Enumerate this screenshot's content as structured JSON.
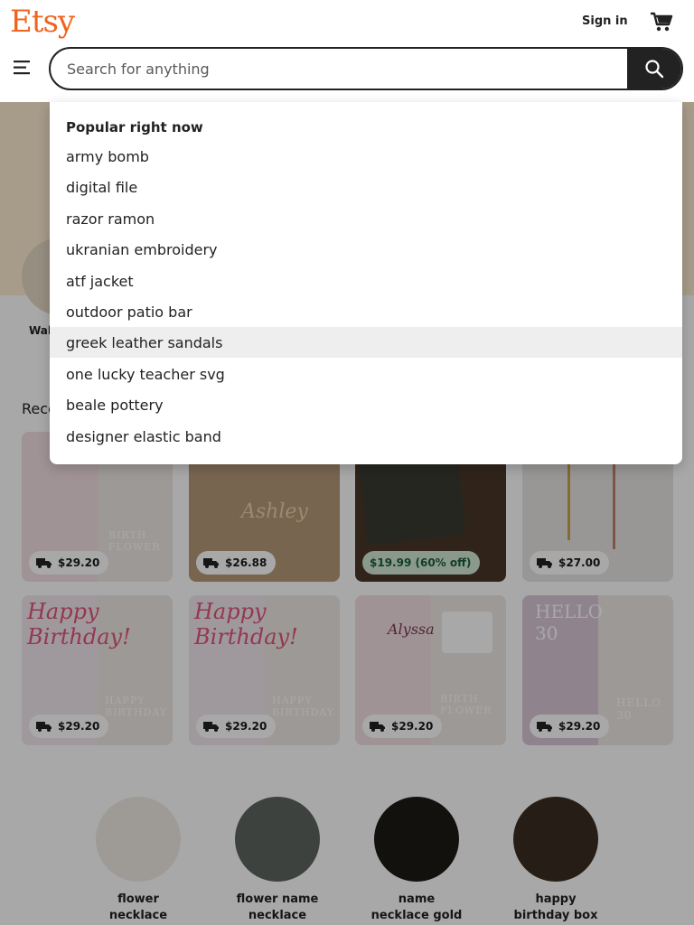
{
  "header": {
    "logo": "Etsy",
    "sign_in": "Sign in",
    "search_placeholder": "Search for anything"
  },
  "colors": {
    "brand": "#F1641E",
    "sale_bg": "#D4E9D7",
    "highlight": "#EEEEEE"
  },
  "dropdown": {
    "title": "Popular right now",
    "items": [
      "army bomb",
      "digital file",
      "razor ramon",
      "ukranian embroidery",
      "atf jacket",
      "outdoor patio bar",
      "greek leather sandals",
      "one lucky teacher svg",
      "beale pottery",
      "designer elastic band"
    ],
    "highlighted_index": 6
  },
  "page": {
    "partial_category_label": "Wal",
    "recent_title_partial": "Rece",
    "cards": [
      {
        "price": "$29.20",
        "free_delivery": true,
        "deco": "BIRTH FLOWER"
      },
      {
        "price": "$26.88",
        "free_delivery": true,
        "deco": ""
      },
      {
        "price": "$19.99 (60% off)",
        "free_delivery": false,
        "deco": ""
      },
      {
        "price": "$27.00",
        "free_delivery": true,
        "deco": ""
      },
      {
        "price": "$29.20",
        "free_delivery": true,
        "deco": "HAPPY BIRTHDAY"
      },
      {
        "price": "$29.20",
        "free_delivery": true,
        "deco": "HAPPY BIRTHDAY"
      },
      {
        "price": "$29.20",
        "free_delivery": true,
        "deco": "BIRTH FLOWER"
      },
      {
        "price": "$29.20",
        "free_delivery": true,
        "deco": "HELLO 30"
      }
    ],
    "bottom_categories": [
      {
        "line1": "flower",
        "line2": "necklace"
      },
      {
        "line1": "flower name",
        "line2": "necklace"
      },
      {
        "line1": "name",
        "line2": "necklace gold"
      },
      {
        "line1": "happy",
        "line2": "birthday box"
      }
    ]
  }
}
